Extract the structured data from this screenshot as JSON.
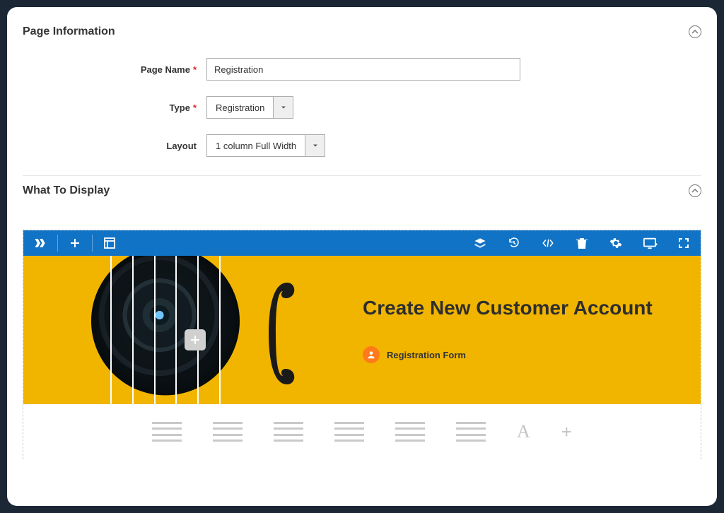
{
  "colors": {
    "toolbar": "#1073c6",
    "hero_bg": "#f1b500",
    "accent_orange": "#ff7a1a"
  },
  "sections": {
    "page_info": {
      "title": "Page Information"
    },
    "what_to_display": {
      "title": "What To Display"
    }
  },
  "form": {
    "page_name": {
      "label": "Page Name",
      "required": true,
      "value": "Registration"
    },
    "type": {
      "label": "Type",
      "required": true,
      "value": "Registration"
    },
    "layout": {
      "label": "Layout",
      "required": false,
      "value": "1 column Full Width"
    }
  },
  "builder": {
    "toolbar_left": [
      "brand",
      "add",
      "template"
    ],
    "toolbar_right": [
      "layers",
      "history",
      "code",
      "delete",
      "settings",
      "preview",
      "fullscreen"
    ],
    "hero": {
      "title": "Create New Customer Account",
      "component_label": "Registration Form"
    },
    "block_options": [
      "1-col",
      "2-col",
      "3-col",
      "4-col",
      "5-col",
      "6-col",
      "text",
      "add"
    ]
  }
}
